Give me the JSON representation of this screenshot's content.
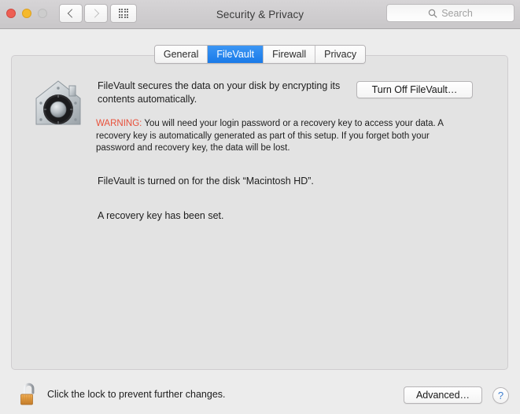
{
  "window": {
    "title": "Security & Privacy",
    "traffic_lights": [
      {
        "name": "close",
        "color": "#ee5f54"
      },
      {
        "name": "minimize",
        "color": "#f5b92c"
      },
      {
        "name": "zoom",
        "color": "#cdcdcd"
      }
    ],
    "nav": {
      "back_icon": "chevron-left-icon",
      "forward_icon": "chevron-right-icon",
      "grid_icon": "show-all-grid-icon"
    },
    "search": {
      "icon": "search-icon",
      "placeholder": "Search",
      "value": ""
    }
  },
  "tabs": [
    {
      "label": "General",
      "active": false
    },
    {
      "label": "FileVault",
      "active": true
    },
    {
      "label": "Firewall",
      "active": false
    },
    {
      "label": "Privacy",
      "active": false
    }
  ],
  "main": {
    "icon": "filevault-safe-icon",
    "description": "FileVault secures the data on your disk by encrypting its contents automatically.",
    "turn_off_button": "Turn Off FileVault…",
    "warning": {
      "label": "WARNING:",
      "text": "You will need your login password or a recovery key to access your data. A recovery key is automatically generated as part of this setup. If you forget both your password and recovery key, the data will be lost.",
      "color": "#e8503a"
    },
    "status_primary": "FileVault is turned on for the disk “Macintosh HD”.",
    "status_secondary": "A recovery key has been set."
  },
  "footer": {
    "lock_icon": "unlocked-padlock-icon",
    "lock_text": "Click the lock to prevent further changes.",
    "advanced_button": "Advanced…",
    "help_button": "?",
    "accent_color": "#197ae8"
  }
}
